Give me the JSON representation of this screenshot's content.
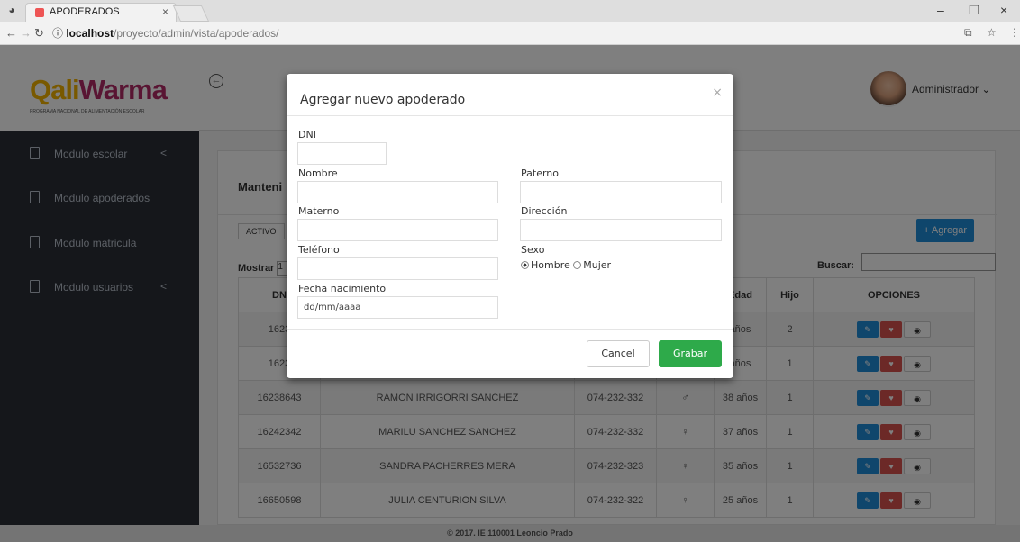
{
  "browser": {
    "tab_title": "APODERADOS",
    "url_host": "localhost",
    "url_path": "/proyecto/admin/vista/apoderados/"
  },
  "header": {
    "logo_text_a": "Qali",
    "logo_text_b": "Warma",
    "logo_subtitle": "PROGRAMA NACIONAL DE ALIMENTACIÓN ESCOLAR",
    "user_name": "Administrador"
  },
  "sidebar": {
    "items": [
      {
        "label": "Modulo escolar",
        "chevron": "<"
      },
      {
        "label": "Modulo apoderados",
        "chevron": ""
      },
      {
        "label": "Modulo matricula",
        "chevron": ""
      },
      {
        "label": "Modulo usuarios",
        "chevron": "<"
      }
    ]
  },
  "panel": {
    "title": "Manteni",
    "chip": "ACTIVO",
    "add_label": "+ Agregar",
    "show_label": "Mostrar",
    "show_value": "1",
    "search_label": "Buscar:",
    "columns": [
      "DN",
      "",
      "",
      "",
      "Edad",
      "Hijo",
      "OPCIONES"
    ],
    "rows": [
      {
        "dni": "1623",
        "name": "",
        "phone": "",
        "age": "años",
        "kids": "2"
      },
      {
        "dni": "1623",
        "name": "",
        "phone": "",
        "age": "años",
        "kids": "1"
      },
      {
        "dni": "16238643",
        "name": "RAMON IRRIGORRI SANCHEZ",
        "phone": "074-232-332",
        "age": "38 años",
        "kids": "1"
      },
      {
        "dni": "16242342",
        "name": "MARILU SANCHEZ SANCHEZ",
        "phone": "074-232-332",
        "age": "37 años",
        "kids": "1"
      },
      {
        "dni": "16532736",
        "name": "SANDRA PACHERRES MERA",
        "phone": "074-232-323",
        "age": "35 años",
        "kids": "1"
      },
      {
        "dni": "16650598",
        "name": "JULIA CENTURION SILVA",
        "phone": "074-232-322",
        "age": "25 años",
        "kids": "1"
      }
    ]
  },
  "footer": {
    "text": "© 2017. IE 110001 Leoncio Prado"
  },
  "modal": {
    "title": "Agregar nuevo apoderado",
    "close": "×",
    "labels": {
      "dni": "DNI",
      "nombre": "Nombre",
      "paterno": "Paterno",
      "materno": "Materno",
      "direccion": "Dirección",
      "telefono": "Teléfono",
      "sexo": "Sexo",
      "hombre": "Hombre",
      "mujer": "Mujer",
      "fecha": "Fecha nacimiento"
    },
    "date_placeholder": "dd/mm/aaaa",
    "cancel": "Cancel",
    "save": "Grabar"
  }
}
